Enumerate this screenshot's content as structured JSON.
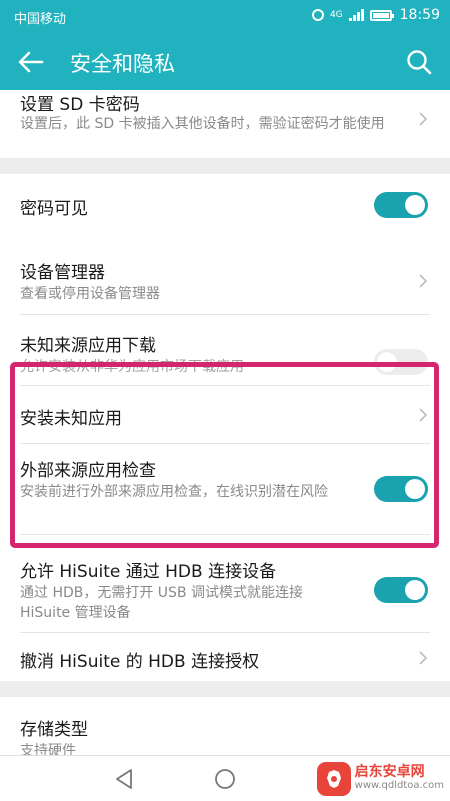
{
  "status_bar": {
    "carrier": "中国移动",
    "network": "4G",
    "time": "18:59"
  },
  "app_bar": {
    "title": "安全和隐私"
  },
  "settings": {
    "sd_password": {
      "title": "设置 SD 卡密码",
      "subtitle": "设置后，此 SD 卡被插入其他设备时，需验证密码才能使用"
    },
    "password_visible": {
      "title": "密码可见",
      "enabled": true
    },
    "device_admin": {
      "title": "设备管理器",
      "subtitle": "查看或停用设备管理器"
    },
    "unknown_sources": {
      "title": "未知来源应用下载",
      "subtitle": "允许安装从非华为应用市场下载应用",
      "enabled": false
    },
    "install_unknown": {
      "title": "安装未知应用"
    },
    "external_check": {
      "title": "外部来源应用检查",
      "subtitle": "安装前进行外部来源应用检查，在线识别潜在风险",
      "enabled": true
    },
    "hisuite_hdb": {
      "title": "允许 HiSuite 通过 HDB 连接设备",
      "subtitle": "通过 HDB，无需打开 USB 调试模式就能连接 HiSuite 管理设备",
      "enabled": true
    },
    "revoke_hdb": {
      "title": "撤消 HiSuite 的 HDB 连接授权"
    },
    "storage_type": {
      "title": "存储类型",
      "subtitle": "支持硬件"
    }
  },
  "watermark": {
    "name": "启东安卓网",
    "url": "www.qdldtoa.com"
  },
  "colors": {
    "accent": "#20b2be",
    "switch_on": "#1aa2ae",
    "highlight": "#d4266f"
  }
}
